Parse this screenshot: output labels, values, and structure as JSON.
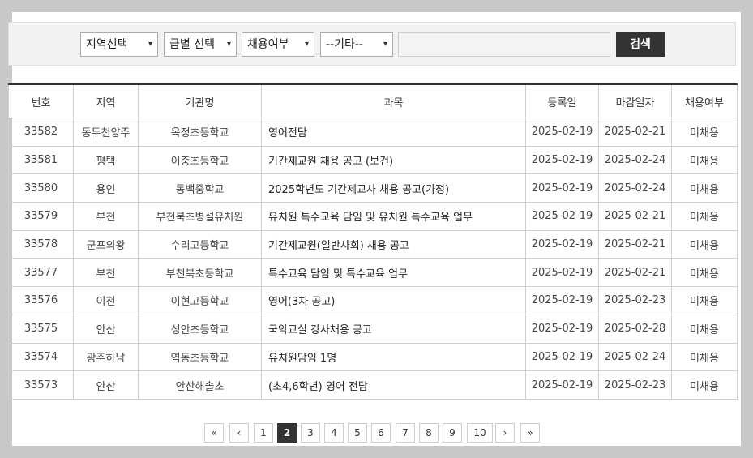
{
  "filters": {
    "region": "지역선택",
    "grade": "급별 선택",
    "hiring": "채용여부",
    "other": "--기타--",
    "keyword_value": "",
    "search_label": "검색"
  },
  "table": {
    "headers": [
      "번호",
      "지역",
      "기관명",
      "과목",
      "등록일",
      "마감일자",
      "채용여부"
    ],
    "rows": [
      [
        "33582",
        "동두천양주",
        "옥정초등학교",
        "영어전담",
        "2025-02-19",
        "2025-02-21",
        "미채용"
      ],
      [
        "33581",
        "평택",
        "이충초등학교",
        "기간제교원 채용 공고 (보건)",
        "2025-02-19",
        "2025-02-24",
        "미채용"
      ],
      [
        "33580",
        "용인",
        "동백중학교",
        "2025학년도 기간제교사 채용 공고(가정)",
        "2025-02-19",
        "2025-02-24",
        "미채용"
      ],
      [
        "33579",
        "부천",
        "부천북초병설유치원",
        "유치원 특수교육 담임 및 유치원 특수교육 업무",
        "2025-02-19",
        "2025-02-21",
        "미채용"
      ],
      [
        "33578",
        "군포의왕",
        "수리고등학교",
        "기간제교원(일반사회) 채용 공고",
        "2025-02-19",
        "2025-02-21",
        "미채용"
      ],
      [
        "33577",
        "부천",
        "부천북초등학교",
        "특수교육 담임 및 특수교육 업무",
        "2025-02-19",
        "2025-02-21",
        "미채용"
      ],
      [
        "33576",
        "이천",
        "이현고등학교",
        "영어(3차 공고)",
        "2025-02-19",
        "2025-02-23",
        "미채용"
      ],
      [
        "33575",
        "안산",
        "성안초등학교",
        "국악교실 강사채용 공고",
        "2025-02-19",
        "2025-02-28",
        "미채용"
      ],
      [
        "33574",
        "광주하남",
        "역동초등학교",
        "유치원담임 1명",
        "2025-02-19",
        "2025-02-24",
        "미채용"
      ],
      [
        "33573",
        "안산",
        "안산해솔초",
        "(초4,6학년) 영어 전담",
        "2025-02-19",
        "2025-02-23",
        "미채용"
      ]
    ]
  },
  "pagination": {
    "first": "«",
    "prev": "‹",
    "pages": [
      "1",
      "2",
      "3",
      "4",
      "5",
      "6",
      "7",
      "8",
      "9",
      "10"
    ],
    "current": "2",
    "next": "›",
    "last": "»"
  }
}
